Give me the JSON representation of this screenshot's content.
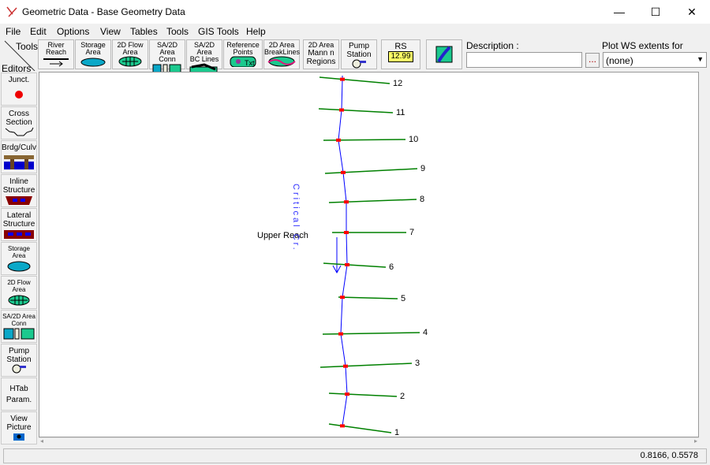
{
  "window": {
    "title": "Geometric Data - Base Geometry Data",
    "minimize": "—",
    "maximize": "☐",
    "close": "✕"
  },
  "menu": [
    "File",
    "Edit",
    "Options",
    "View",
    "Tables",
    "Tools",
    "GIS Tools",
    "Help"
  ],
  "toolbar": {
    "tools_label": "Tools",
    "editors_label": "Editors",
    "buttons": [
      {
        "l1": "River",
        "l2": "Reach"
      },
      {
        "l1": "Storage",
        "l2": "Area"
      },
      {
        "l1": "2D Flow",
        "l2": "Area"
      },
      {
        "l1": "SA/2D Area",
        "l2": "Conn"
      },
      {
        "l1": "SA/2D Area",
        "l2": "BC Lines"
      },
      {
        "l1": "Reference",
        "l2": "Points"
      },
      {
        "l1": "2D Area",
        "l2": "BreakLines"
      },
      {
        "l1": "2D Area",
        "l2": "Mann n Regions"
      },
      {
        "l1": "Pump",
        "l2": "Station"
      },
      {
        "l1": "RS",
        "l2": "12.99"
      }
    ],
    "description_label": "Description :",
    "description_value": "",
    "browse_label": "...",
    "profile_label": "Plot WS extents for Profile:",
    "profile_value": "(none)"
  },
  "editors": [
    {
      "l1": "Junct.",
      "l2": ""
    },
    {
      "l1": "Cross",
      "l2": "Section"
    },
    {
      "l1": "Brdg/Culv",
      "l2": ""
    },
    {
      "l1": "Inline",
      "l2": "Structure"
    },
    {
      "l1": "Lateral",
      "l2": "Structure"
    },
    {
      "l1": "Storage",
      "l2": "Area"
    },
    {
      "l1": "2D Flow",
      "l2": "Area"
    },
    {
      "l1": "SA/2D Area",
      "l2": "Conn"
    },
    {
      "l1": "Pump",
      "l2": "Station"
    },
    {
      "l1": "HTab",
      "l2": "Param."
    },
    {
      "l1": "View",
      "l2": "Picture"
    }
  ],
  "schematic": {
    "river_name": "Critical Cr.",
    "reach_name": "Upper Reach",
    "cross_sections": [
      "12",
      "11",
      "10",
      "9",
      "8",
      "7",
      "6",
      "5",
      "4",
      "3",
      "2",
      "1"
    ],
    "colors": {
      "river": "#0000ff",
      "xs": "#008000",
      "node": "#ff0000"
    }
  },
  "status": {
    "coords": "0.8166, 0.5578"
  }
}
